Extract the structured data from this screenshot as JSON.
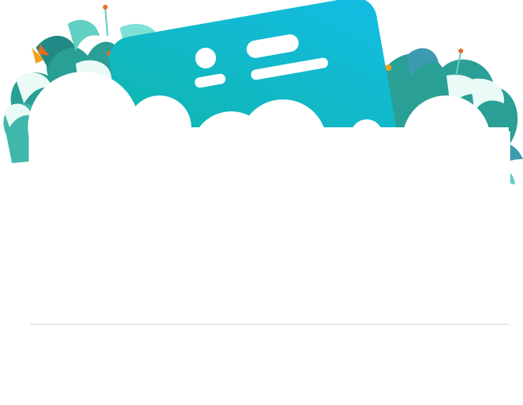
{
  "illustration": {
    "name": "id-card-in-flowers",
    "card_gradient": [
      "#12c0e2",
      "#11b3a0"
    ],
    "leaf_colors": [
      "#1f8a86",
      "#2aa79b",
      "#5fd0c2",
      "#7fe0d6",
      "#3c9bb0"
    ],
    "petal_color": "#eafaf6",
    "accent_colors": [
      "#f0a21a",
      "#e86a1f"
    ]
  },
  "divider_color": "#d9d9d9"
}
